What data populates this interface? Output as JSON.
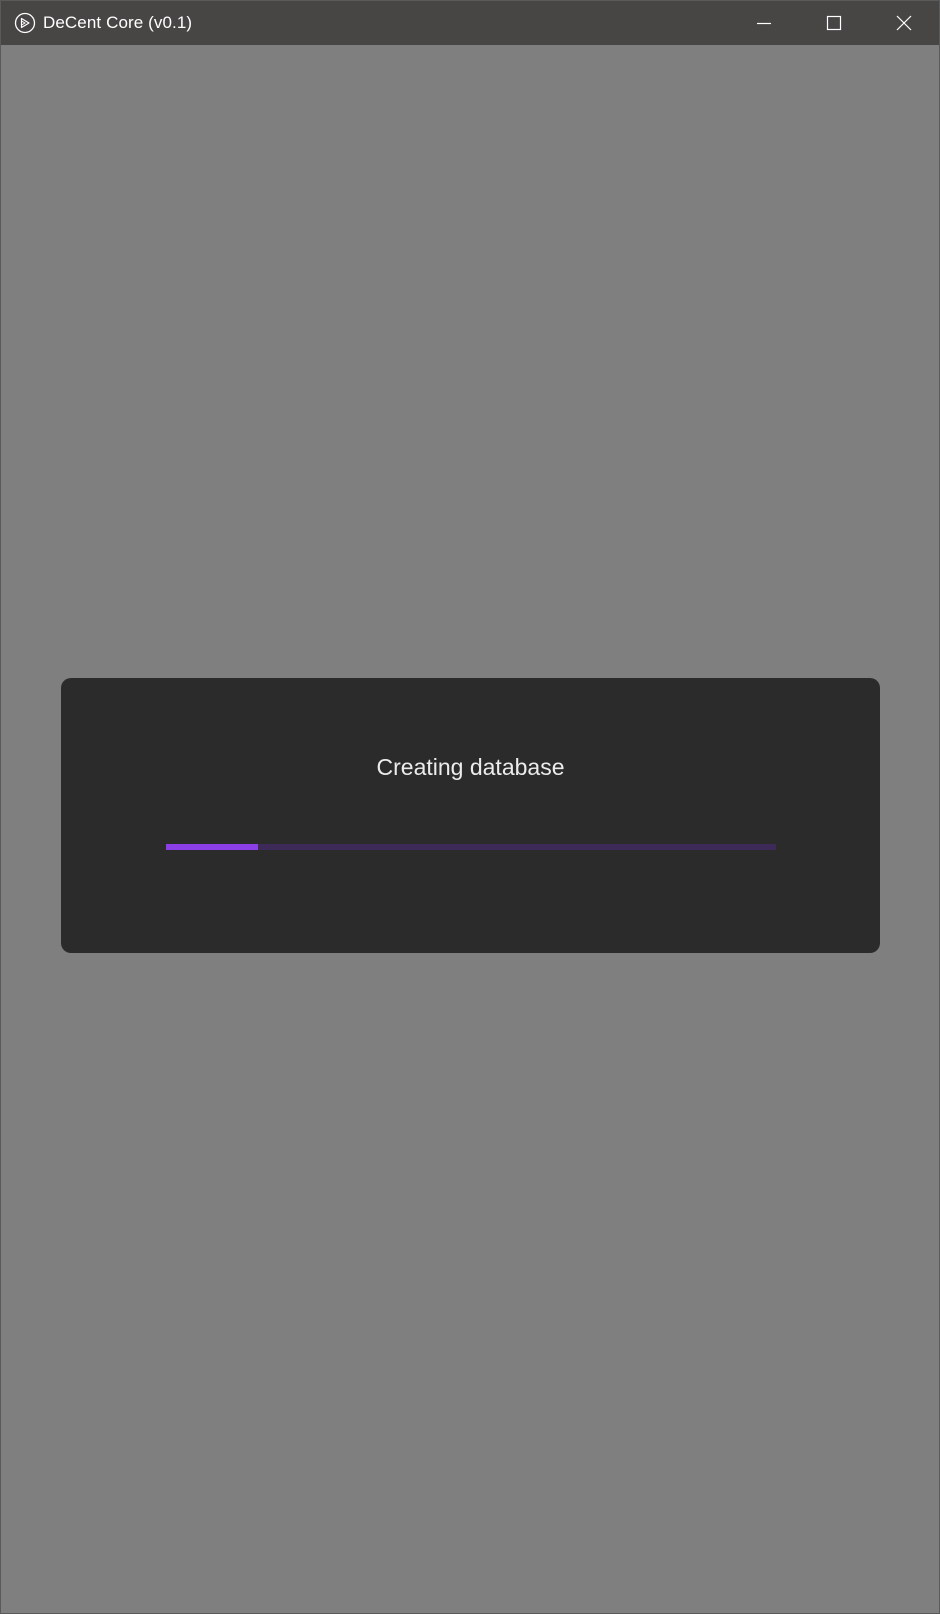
{
  "window": {
    "title": "DeCent Core (v0.1)",
    "icon": "decent-logo-icon",
    "controls": [
      "minimize-icon",
      "maximize-icon",
      "close-icon"
    ]
  },
  "dialog": {
    "message": "Creating database",
    "progress": 0.15
  },
  "colors": {
    "titlebar": "#474645",
    "background": "#7f7f7f",
    "dialog": "#2b2b2b",
    "progress_fill": "#8c3fe6",
    "progress_track": "#3d2a58"
  }
}
